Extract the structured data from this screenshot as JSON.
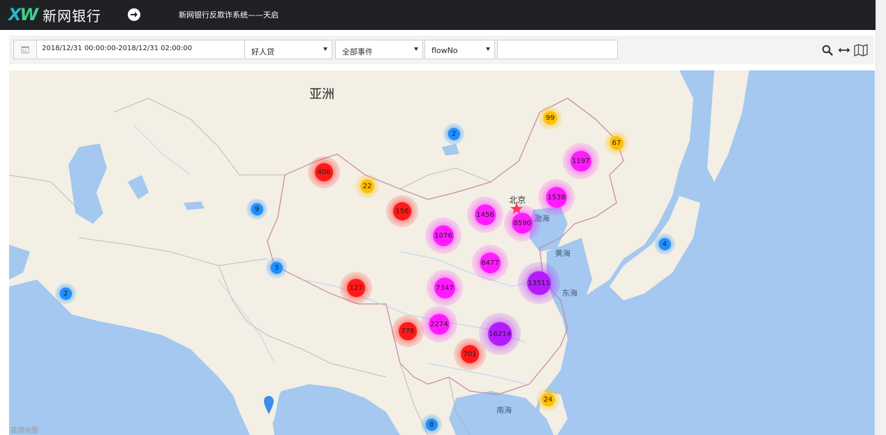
{
  "header": {
    "logo_text": "XW",
    "brand_name": "新网银行",
    "system_title": "新网银行反欺诈系统——天启"
  },
  "filters": {
    "date_range": "2018/12/31 00:00:00-2018/12/31 02:00:00",
    "product_select": "好人贷",
    "event_select": "全部事件",
    "field_select": "flowNo",
    "search_value": ""
  },
  "tools": {
    "search_icon": "search-icon",
    "expand_icon": "arrows-horizontal-icon",
    "map_icon": "map-icon"
  },
  "map": {
    "labels": {
      "asia": "亚洲",
      "beijing": "北京",
      "bohai": "渤海",
      "yellow_sea": "黄海",
      "east_sea": "东海",
      "south_sea": "南海"
    },
    "attribution": "高德地图",
    "colors": {
      "blue": "#1e8fff",
      "yellow": "#ffbf00",
      "red": "#ff1a1a",
      "magenta": "#ff1aff",
      "purple": "#b51aff"
    },
    "clusters": [
      {
        "count": "2",
        "level": "blue"
      },
      {
        "count": "99",
        "level": "yellow"
      },
      {
        "count": "67",
        "level": "yellow"
      },
      {
        "count": "1197",
        "level": "magenta"
      },
      {
        "count": "406",
        "level": "red"
      },
      {
        "count": "22",
        "level": "yellow"
      },
      {
        "count": "9",
        "level": "blue"
      },
      {
        "count": "156",
        "level": "red"
      },
      {
        "count": "1456",
        "level": "magenta"
      },
      {
        "count": "1538",
        "level": "magenta"
      },
      {
        "count": "8590",
        "level": "magenta"
      },
      {
        "count": "1076",
        "level": "magenta"
      },
      {
        "count": "4",
        "level": "blue"
      },
      {
        "count": "3",
        "level": "blue"
      },
      {
        "count": "6477",
        "level": "magenta"
      },
      {
        "count": "2",
        "level": "blue"
      },
      {
        "count": "127",
        "level": "red"
      },
      {
        "count": "7347",
        "level": "magenta"
      },
      {
        "count": "13511",
        "level": "purple"
      },
      {
        "count": "2274",
        "level": "magenta"
      },
      {
        "count": "778",
        "level": "red"
      },
      {
        "count": "16214",
        "level": "purple"
      },
      {
        "count": "701",
        "level": "red"
      },
      {
        "count": "24",
        "level": "yellow"
      },
      {
        "count": "8",
        "level": "blue"
      }
    ]
  }
}
